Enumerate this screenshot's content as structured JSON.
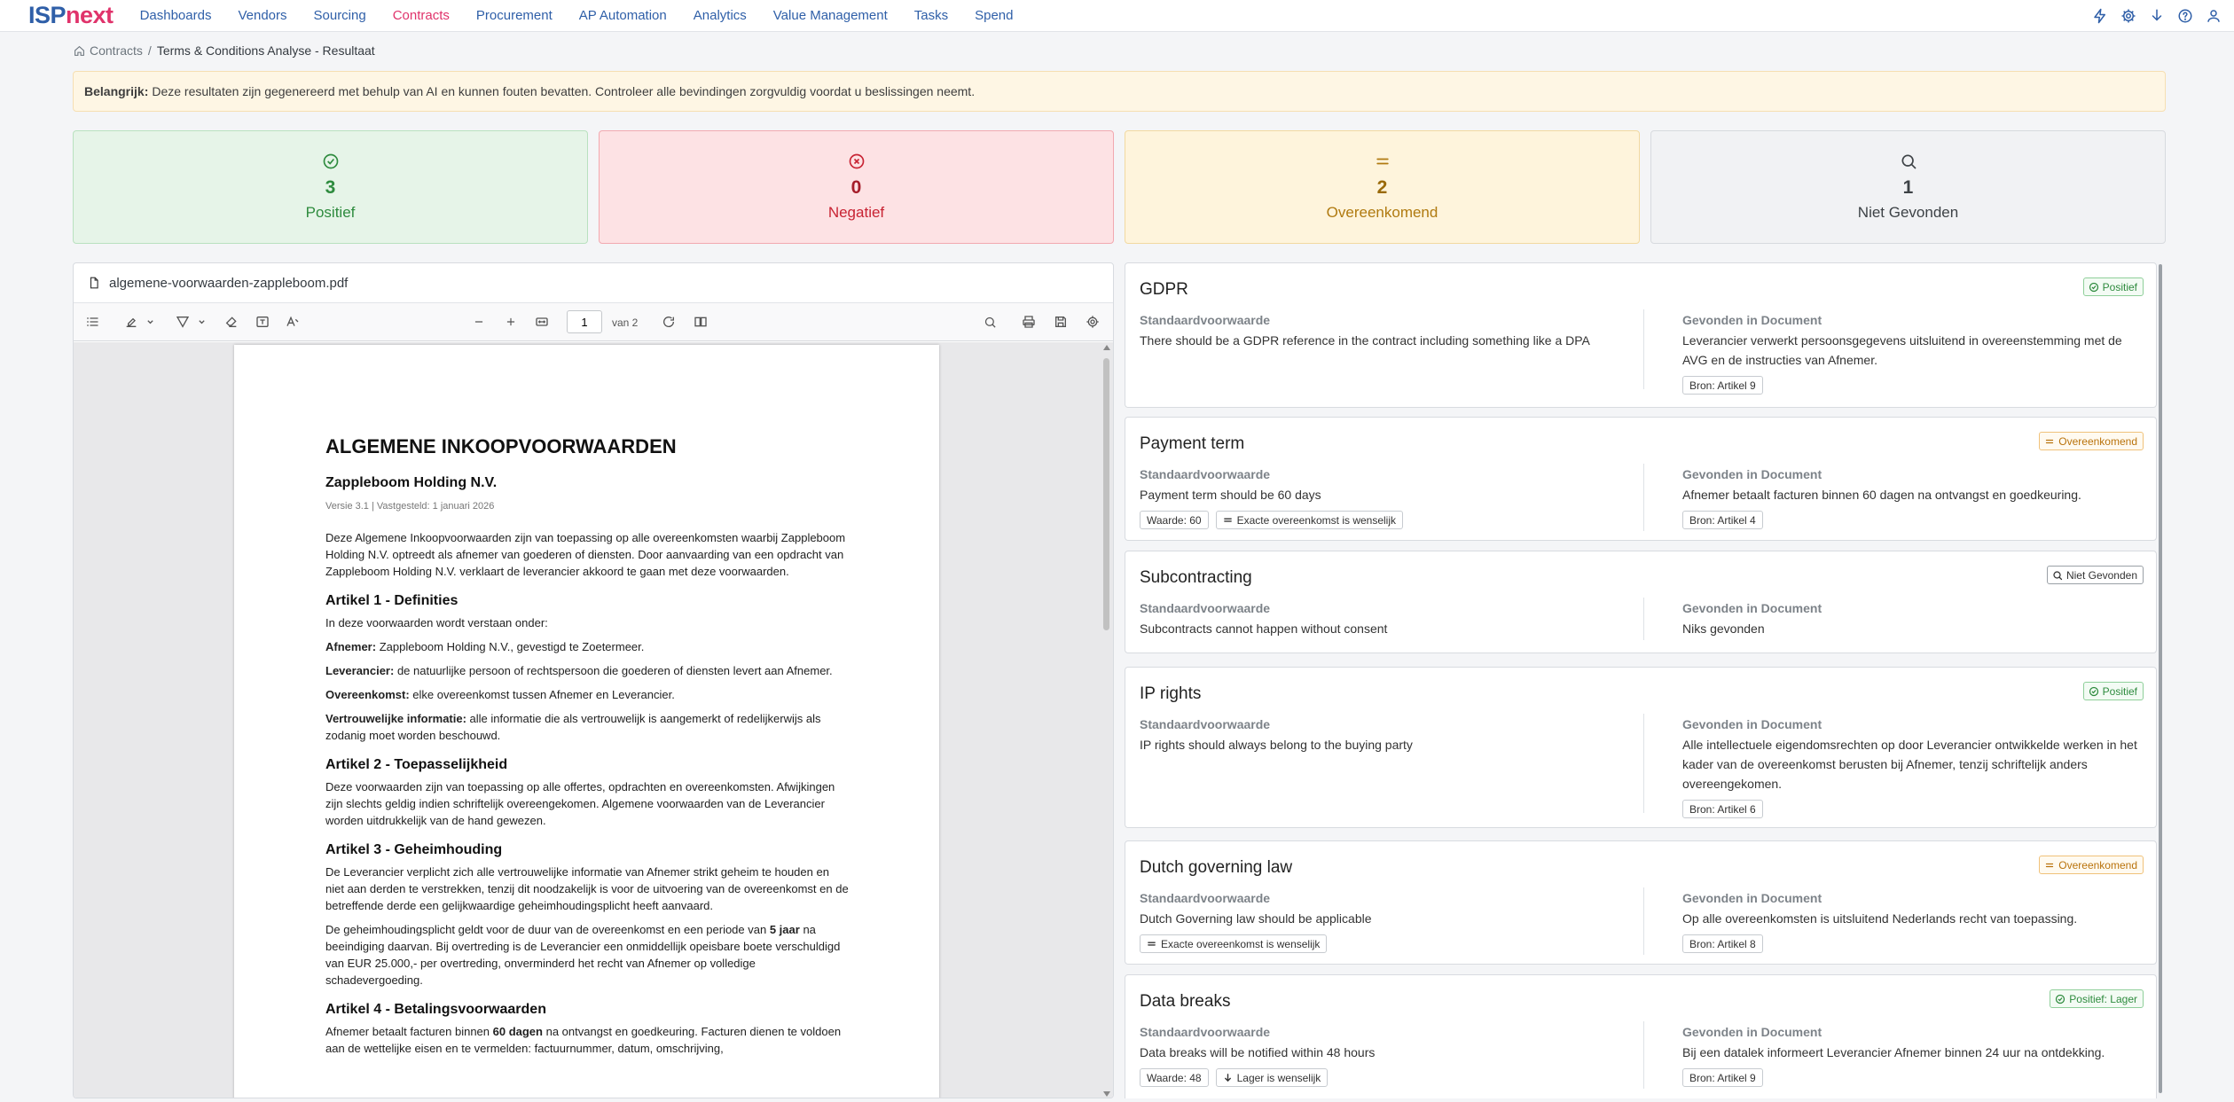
{
  "nav": {
    "logo_isp": "ISP",
    "logo_next": "next",
    "items": [
      "Dashboards",
      "Vendors",
      "Sourcing",
      "Contracts",
      "Procurement",
      "AP Automation",
      "Analytics",
      "Value Management",
      "Tasks",
      "Spend"
    ],
    "active": "Contracts",
    "icons": [
      "bolt-icon",
      "gear-icon",
      "download-icon",
      "help-icon",
      "user-icon"
    ]
  },
  "breadcrumb": {
    "parent": "Contracts",
    "separator": "/",
    "current": "Terms & Conditions Analyse - Resultaat"
  },
  "banner": {
    "label": "Belangrijk:",
    "text": "Deze resultaten zijn gegenereerd met behulp van AI en kunnen fouten bevatten. Controleer alle bevindingen zorgvuldig voordat u beslissingen neemt."
  },
  "stats": {
    "positief": {
      "count": "3",
      "label": "Positief"
    },
    "negatief": {
      "count": "0",
      "label": "Negatief"
    },
    "overeenkomend": {
      "count": "2",
      "label": "Overeenkomend"
    },
    "niet_gevonden": {
      "count": "1",
      "label": "Niet Gevonden"
    }
  },
  "viewer": {
    "filename": "algemene-voorwaarden-zappleboom.pdf",
    "page": "1",
    "page_of": "van 2"
  },
  "doc": {
    "title": "ALGEMENE INKOOPVOORWAARDEN",
    "company": "Zappleboom Holding N.V.",
    "version": "Versie 3.1 | Vastgesteld: 1 januari 2026",
    "intro": "Deze Algemene Inkoopvoorwaarden zijn van toepassing op alle overeenkomsten waarbij Zappleboom Holding N.V. optreedt als afnemer van goederen of diensten. Door aanvaarding van een opdracht van Zappleboom Holding N.V. verklaart de leverancier akkoord te gaan met deze voorwaarden.",
    "a1_title": "Artikel 1 - Definities",
    "a1_intro": "In deze voorwaarden wordt verstaan onder:",
    "a1_afnemer_term": "Afnemer:",
    "a1_afnemer": " Zappleboom Holding N.V., gevestigd te Zoetermeer.",
    "a1_leverancier_term": "Leverancier:",
    "a1_leverancier": " de natuurlijke persoon of rechtspersoon die goederen of diensten levert aan Afnemer.",
    "a1_overeenkomst_term": "Overeenkomst:",
    "a1_overeenkomst": " elke overeenkomst tussen Afnemer en Leverancier.",
    "a1_vertrouwelijk_term": "Vertrouwelijke informatie:",
    "a1_vertrouwelijk": " alle informatie die als vertrouwelijk is aangemerkt of redelijkerwijs als zodanig moet worden beschouwd.",
    "a2_title": "Artikel 2 - Toepasselijkheid",
    "a2_text": "Deze voorwaarden zijn van toepassing op alle offertes, opdrachten en overeenkomsten. Afwijkingen zijn slechts geldig indien schriftelijk overeengekomen. Algemene voorwaarden van de Leverancier worden uitdrukkelijk van de hand gewezen.",
    "a3_title": "Artikel 3 - Geheimhouding",
    "a3_text": "De Leverancier verplicht zich alle vertrouwelijke informatie van Afnemer strikt geheim te houden en niet aan derden te verstrekken, tenzij dit noodzakelijk is voor de uitvoering van de overeenkomst en de betreffende derde een gelijkwaardige geheimhoudingsplicht heeft aanvaard.",
    "a3_text2_a": "De geheimhoudingsplicht geldt voor de duur van de overeenkomst en een periode van ",
    "a3_text2_b": "5 jaar",
    "a3_text2_c": " na beeindiging daarvan. Bij overtreding is de Leverancier een onmiddellijk opeisbare boete verschuldigd van EUR 25.000,- per overtreding, onverminderd het recht van Afnemer op volledige schadevergoeding.",
    "a4_title": "Artikel 4 - Betalingsvoorwaarden",
    "a4_text_a": "Afnemer betaalt facturen binnen ",
    "a4_text_b": "60 dagen",
    "a4_text_c": " na ontvangst en goedkeuring. Facturen dienen te voldoen aan de wettelijke eisen en te vermelden: factuurnummer, datum, omschrijving,"
  },
  "labels": {
    "standard": "Standaardvoorwaarde",
    "found": "Gevonden in Document"
  },
  "cards": [
    {
      "title": "GDPR",
      "badge": "Positief",
      "standard": "There should be a GDPR reference in the contract including something like a DPA",
      "found": "Leverancier verwerkt persoonsgegevens uitsluitend in overeenstemming met de AVG en de instructies van Afnemer.",
      "source": "Bron: Artikel 9"
    },
    {
      "title": "Payment term",
      "badge": "Overeenkomend",
      "standard": "Payment term should be 60 days",
      "value": "Waarde: 60",
      "match": "Exacte overeenkomst is wenselijk",
      "found": "Afnemer betaalt facturen binnen 60 dagen na ontvangst en goedkeuring.",
      "source": "Bron: Artikel 4"
    },
    {
      "title": "Subcontracting",
      "badge": "Niet Gevonden",
      "standard": "Subcontracts cannot happen without consent",
      "found": "Niks gevonden"
    },
    {
      "title": "IP rights",
      "badge": "Positief",
      "standard": "IP rights should always belong to the buying party",
      "found": "Alle intellectuele eigendomsrechten op door Leverancier ontwikkelde werken in het kader van de overeenkomst berusten bij Afnemer, tenzij schriftelijk anders overeengekomen.",
      "source": "Bron: Artikel 6"
    },
    {
      "title": "Dutch governing law",
      "badge": "Overeenkomend",
      "standard": "Dutch Governing law should be applicable",
      "match": "Exacte overeenkomst is wenselijk",
      "found": "Op alle overeenkomsten is uitsluitend Nederlands recht van toepassing.",
      "source": "Bron: Artikel 8"
    },
    {
      "title": "Data breaks",
      "badge": "Positief: Lager",
      "standard": "Data breaks will be notified within 48 hours",
      "value": "Waarde: 48",
      "match": "Lager is wenselijk",
      "found": "Bij een datalek informeert Leverancier Afnemer binnen 24 uur na ontdekking.",
      "source": "Bron: Artikel 9"
    }
  ],
  "colors": {
    "brand_blue": "#2f5fa8",
    "brand_pink": "#e0336b",
    "positive": "#2e8b3e",
    "negative": "#c82333",
    "agree": "#b9730c"
  }
}
